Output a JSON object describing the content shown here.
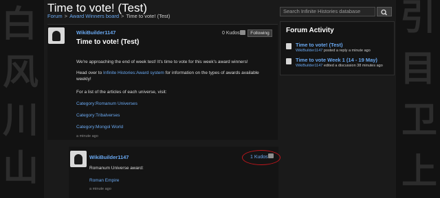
{
  "page": {
    "title": "Time to vote! (Test)",
    "breadcrumb": [
      "Forum",
      "Award Winners board",
      "Time to vote! (Test)"
    ]
  },
  "search": {
    "placeholder": "Search Infinite Histories database",
    "icon": "search-icon"
  },
  "thread": {
    "author": "WikiBuilder1147",
    "heading": "Time to vote! (Test)",
    "kudos": "0 Kudos",
    "follow_label": "Following",
    "paragraph1": "We're approaching the end of week test! It's time to vote for this week's award winners!",
    "paragraph2_prefix": "Head over to ",
    "paragraph2_link": "Infinite Histories:Award system",
    "paragraph2_suffix": " for information on the types of awards available",
    "paragraph2_line2": "weekly!",
    "paragraph3": "For a list of the articles of each universe, visit:",
    "links": [
      "Category:Romanum Universes",
      "Category:Tribalverses",
      "Category:Mongol World"
    ],
    "timestamp": "a minute ago"
  },
  "reply": {
    "author": "WikiBuilder1147",
    "kudos": "1 Kudos",
    "text": "Romanum Universe award:",
    "link": "Roman Empire",
    "timestamp": "a minute ago"
  },
  "forum_activity": {
    "title": "Forum Activity",
    "items": [
      {
        "title": "Time to vote! (Test)",
        "user": "WikiBuilder1147",
        "meta": " posted a reply a minute ago"
      },
      {
        "title": "Time to vote Week 1 (14 - 19 May)",
        "user": "WikiBuilder1147",
        "meta": " edited a discussion 38 minutes ago"
      }
    ]
  },
  "colors": {
    "link": "#6aa9f2",
    "annotation_circle": "#c0161c"
  }
}
